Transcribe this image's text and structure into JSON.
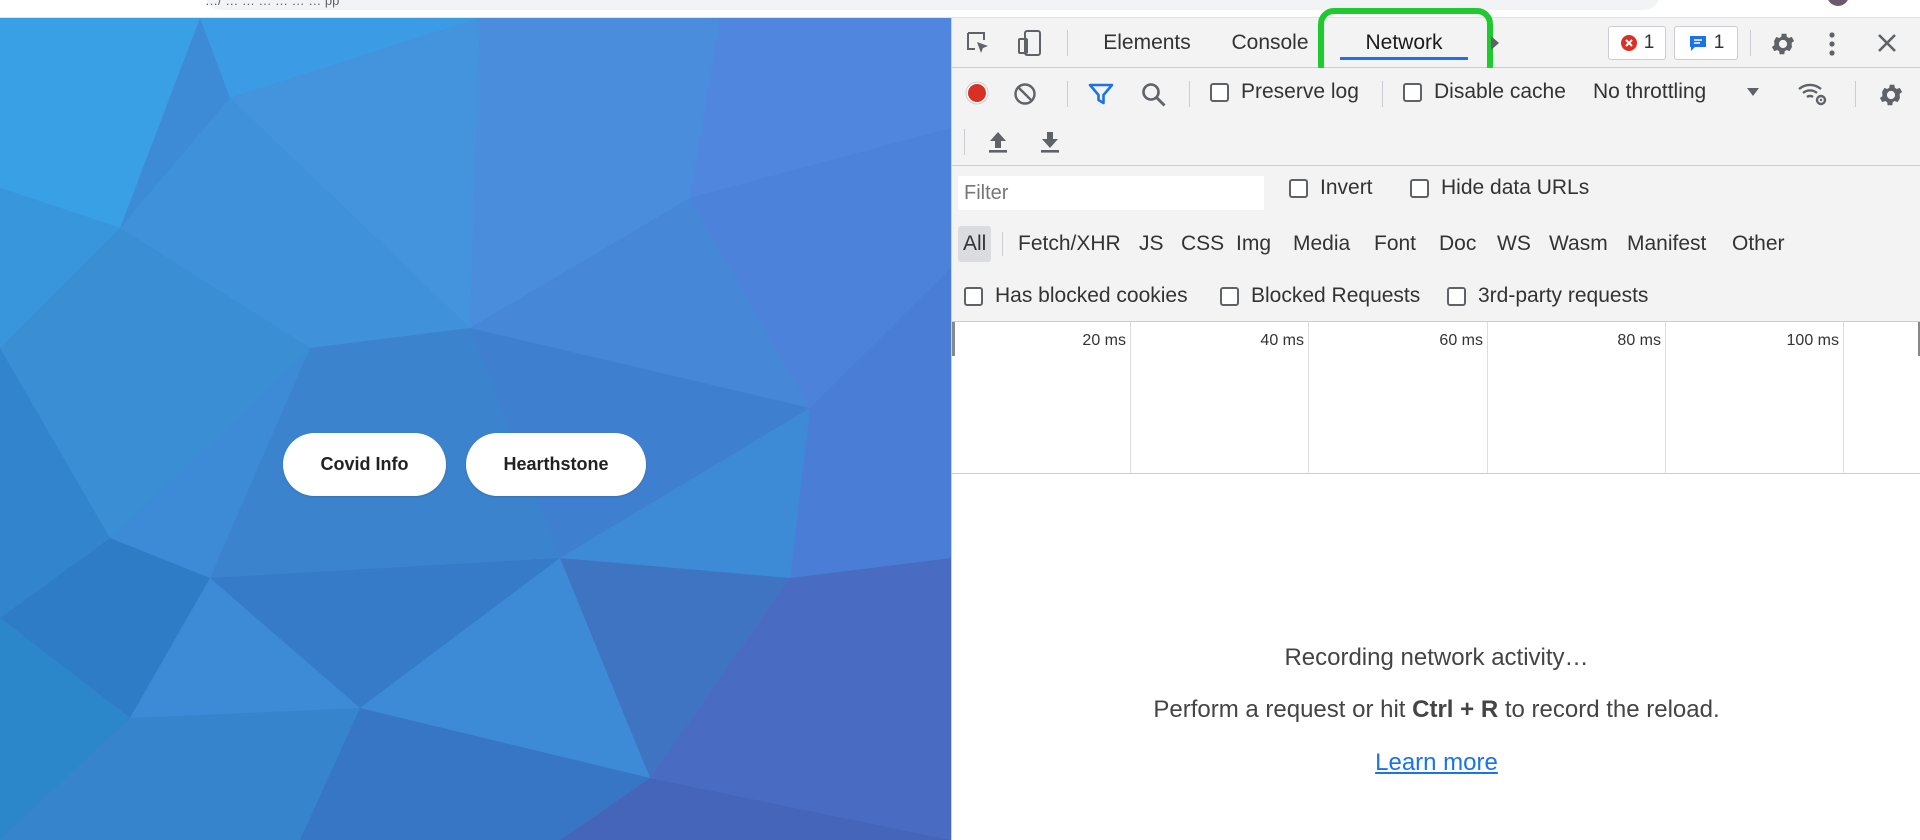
{
  "browser": {
    "address_text": "…/ … … … … … … pp"
  },
  "page": {
    "buttons": [
      {
        "label": "Covid Info"
      },
      {
        "label": "Hearthstone"
      }
    ]
  },
  "devtools": {
    "tabs": [
      {
        "label": "Elements",
        "active": false
      },
      {
        "label": "Console",
        "active": false
      },
      {
        "label": "Network",
        "active": true
      }
    ],
    "more_tabs_icon": "chevron-right-icon",
    "error_count": "1",
    "message_count": "1",
    "toolbar": {
      "preserve_log_label": "Preserve log",
      "disable_cache_label": "Disable cache",
      "throttling_value": "No throttling"
    },
    "filter": {
      "placeholder": "Filter",
      "invert_label": "Invert",
      "hide_data_urls_label": "Hide data URLs"
    },
    "types": [
      "All",
      "Fetch/XHR",
      "JS",
      "CSS",
      "Img",
      "Media",
      "Font",
      "Doc",
      "WS",
      "Wasm",
      "Manifest",
      "Other"
    ],
    "selected_type": "All",
    "request_filters": {
      "blocked_cookies_label": "Has blocked cookies",
      "blocked_requests_label": "Blocked Requests",
      "third_party_label": "3rd-party requests"
    },
    "timeline_ticks": [
      "20 ms",
      "40 ms",
      "60 ms",
      "80 ms",
      "100 ms"
    ],
    "empty_state": {
      "line1": "Recording network activity…",
      "line2_before": "Perform a request or hit ",
      "line2_shortcut": "Ctrl + R",
      "line2_after": " to record the reload.",
      "learn_more": "Learn more"
    },
    "colors": {
      "accent": "#1a73e8",
      "record": "#d93025",
      "highlight": "#1ecb2e"
    }
  }
}
